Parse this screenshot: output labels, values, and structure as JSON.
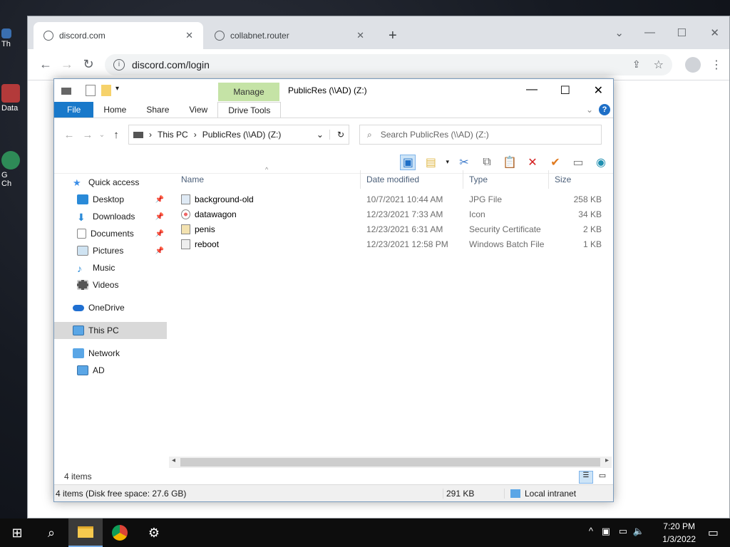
{
  "desktop": {
    "icons": [
      {
        "label": "Th"
      },
      {
        "label": "Data"
      },
      {
        "label": "G\nCh"
      }
    ]
  },
  "chrome": {
    "tabs": [
      {
        "label": "discord.com",
        "close": "✕"
      },
      {
        "label": "collabnet.router",
        "close": "✕"
      }
    ],
    "new_tab": "+",
    "url": "discord.com/login"
  },
  "explorer": {
    "manage_tab": "Manage",
    "title": "PublicRes (\\\\AD) (Z:)",
    "ribbon_tabs": [
      "File",
      "Home",
      "Share",
      "View",
      "Drive Tools"
    ],
    "breadcrumb": [
      "This PC",
      "PublicRes (\\\\AD) (Z:)"
    ],
    "search_placeholder": "Search PublicRes (\\\\AD) (Z:)",
    "nav": {
      "quick_access": "Quick access",
      "pinned": [
        "Desktop",
        "Downloads",
        "Documents",
        "Pictures"
      ],
      "others": [
        "Music",
        "Videos"
      ],
      "onedrive": "OneDrive",
      "this_pc": "This PC",
      "network": "Network",
      "ad": "AD"
    },
    "columns": [
      "Name",
      "Date modified",
      "Type",
      "Size"
    ],
    "files": [
      {
        "name": "background-old",
        "date": "10/7/2021 10:44 AM",
        "type": "JPG File",
        "size": "258 KB"
      },
      {
        "name": "datawagon",
        "date": "12/23/2021 7:33 AM",
        "type": "Icon",
        "size": "34 KB"
      },
      {
        "name": "penis",
        "date": "12/23/2021 6:31 AM",
        "type": "Security Certificate",
        "size": "2 KB"
      },
      {
        "name": "reboot",
        "date": "12/23/2021 12:58 PM",
        "type": "Windows Batch File",
        "size": "1 KB"
      }
    ],
    "items_count": "4 items",
    "status": {
      "summary": "4 items (Disk free space: 27.6 GB)",
      "size": "291 KB",
      "zone": "Local intranet"
    }
  },
  "taskbar": {
    "time": "7:20 PM",
    "date": "1/3/2022"
  }
}
